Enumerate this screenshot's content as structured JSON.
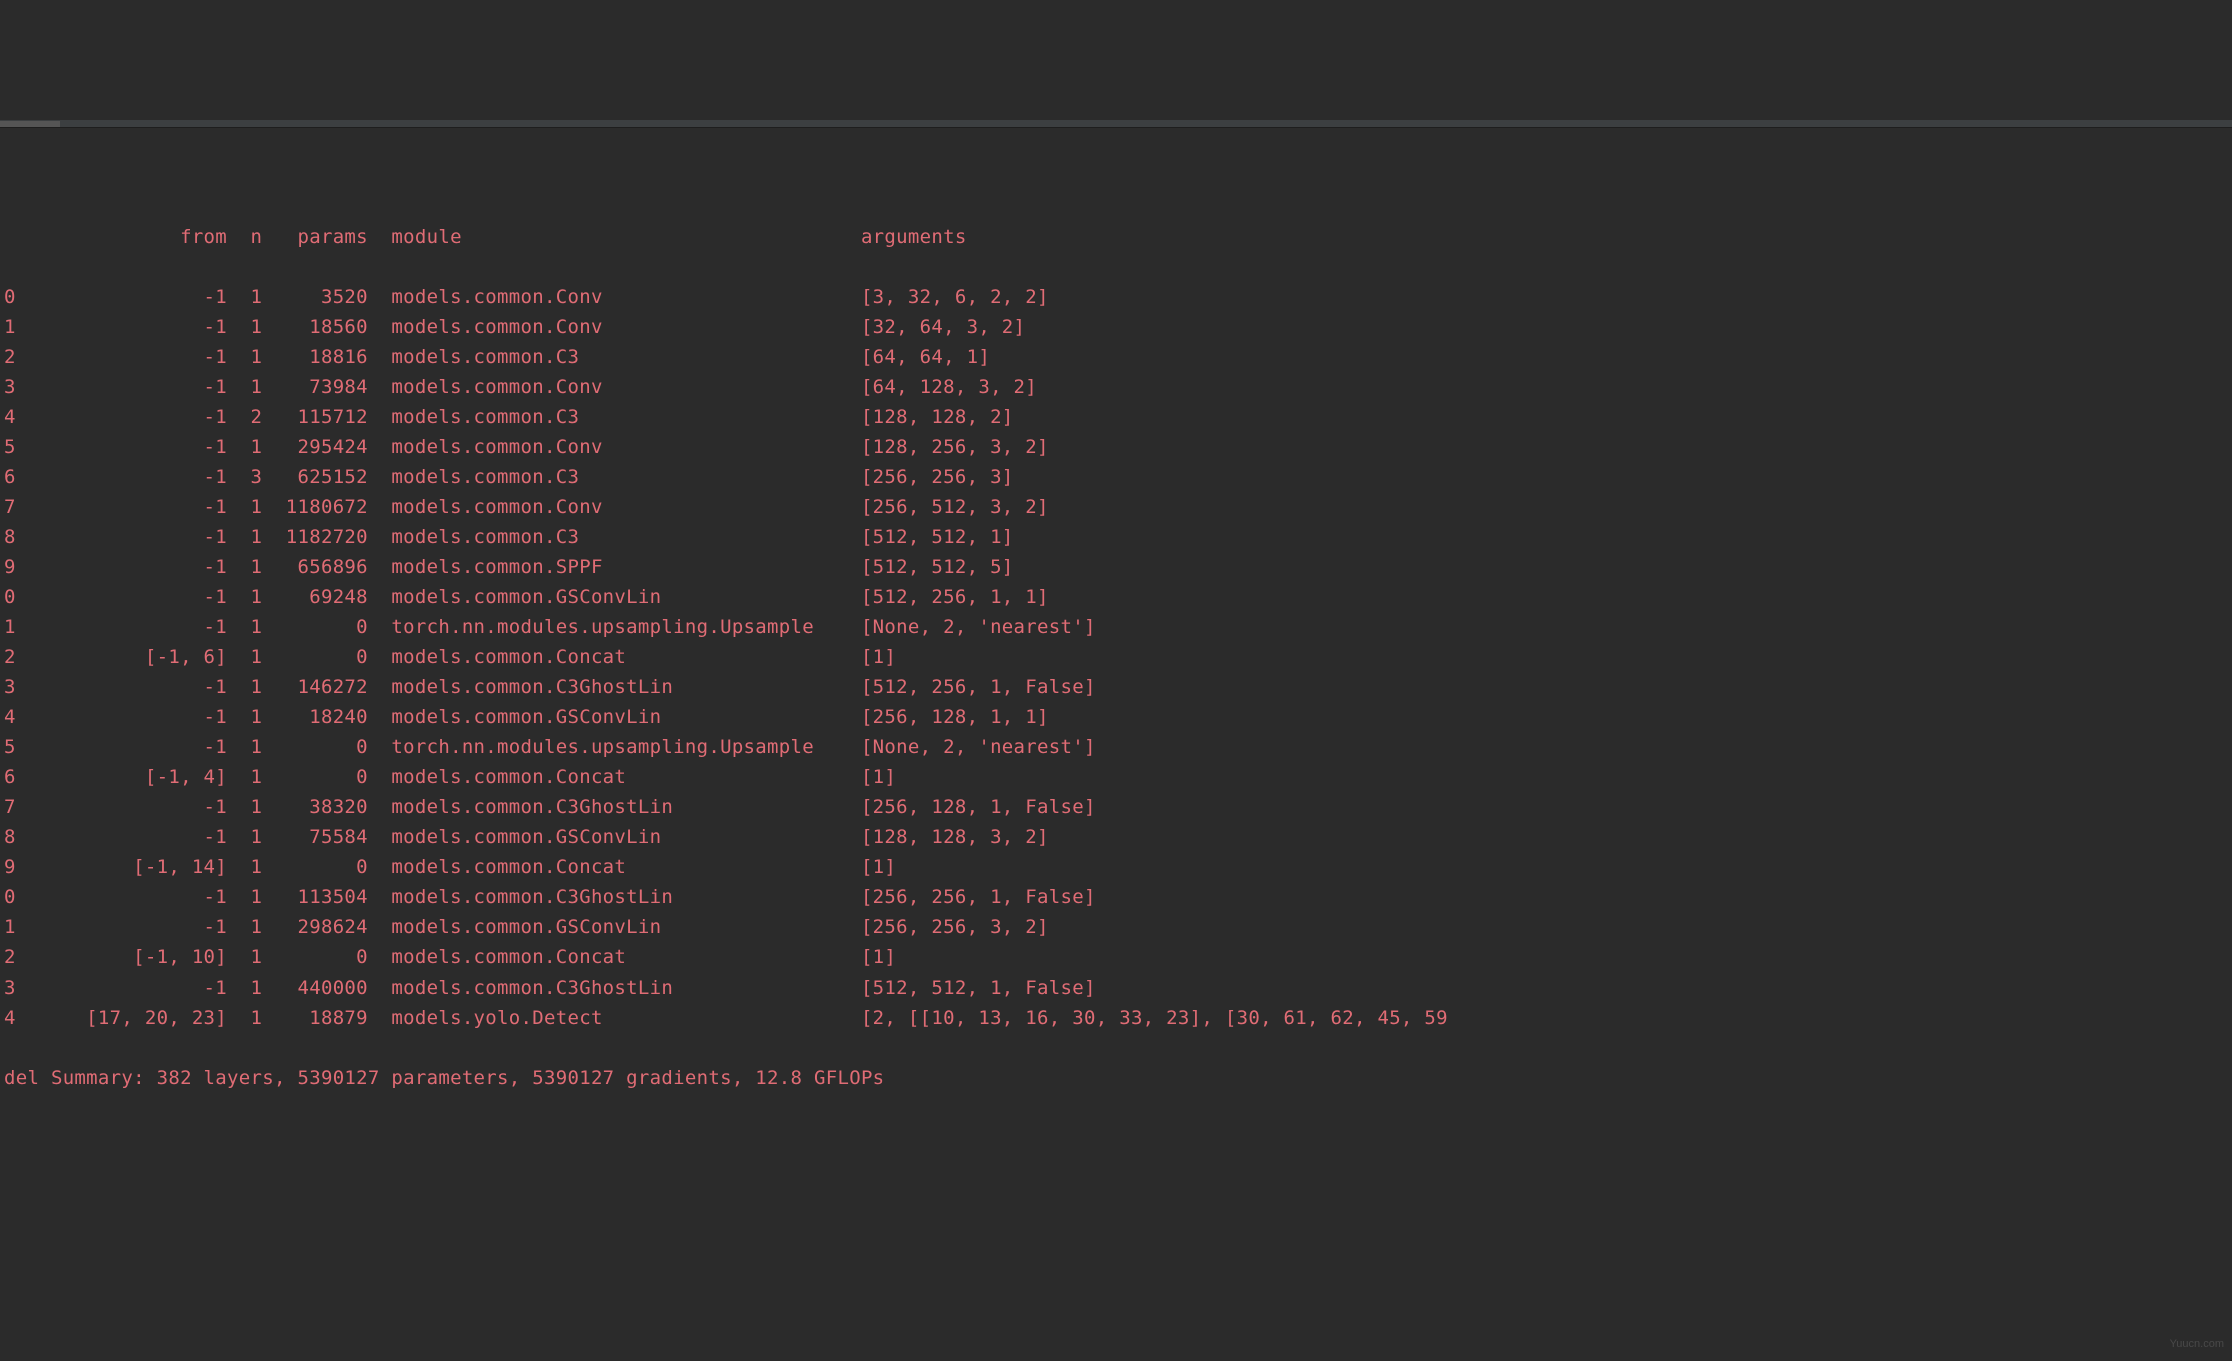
{
  "header": {
    "idx_spacer": "  ",
    "from_label": "from",
    "n_label": "n",
    "params_label": "params",
    "module_label": "module",
    "arguments_label": "arguments"
  },
  "rows": [
    {
      "idx": "0",
      "from": "-1",
      "n": "1",
      "params": "3520",
      "module": "models.common.Conv",
      "arguments": "[3, 32, 6, 2, 2]"
    },
    {
      "idx": "1",
      "from": "-1",
      "n": "1",
      "params": "18560",
      "module": "models.common.Conv",
      "arguments": "[32, 64, 3, 2]"
    },
    {
      "idx": "2",
      "from": "-1",
      "n": "1",
      "params": "18816",
      "module": "models.common.C3",
      "arguments": "[64, 64, 1]"
    },
    {
      "idx": "3",
      "from": "-1",
      "n": "1",
      "params": "73984",
      "module": "models.common.Conv",
      "arguments": "[64, 128, 3, 2]"
    },
    {
      "idx": "4",
      "from": "-1",
      "n": "2",
      "params": "115712",
      "module": "models.common.C3",
      "arguments": "[128, 128, 2]"
    },
    {
      "idx": "5",
      "from": "-1",
      "n": "1",
      "params": "295424",
      "module": "models.common.Conv",
      "arguments": "[128, 256, 3, 2]"
    },
    {
      "idx": "6",
      "from": "-1",
      "n": "3",
      "params": "625152",
      "module": "models.common.C3",
      "arguments": "[256, 256, 3]"
    },
    {
      "idx": "7",
      "from": "-1",
      "n": "1",
      "params": "1180672",
      "module": "models.common.Conv",
      "arguments": "[256, 512, 3, 2]"
    },
    {
      "idx": "8",
      "from": "-1",
      "n": "1",
      "params": "1182720",
      "module": "models.common.C3",
      "arguments": "[512, 512, 1]"
    },
    {
      "idx": "9",
      "from": "-1",
      "n": "1",
      "params": "656896",
      "module": "models.common.SPPF",
      "arguments": "[512, 512, 5]"
    },
    {
      "idx": "0",
      "from": "-1",
      "n": "1",
      "params": "69248",
      "module": "models.common.GSConvLin",
      "arguments": "[512, 256, 1, 1]"
    },
    {
      "idx": "1",
      "from": "-1",
      "n": "1",
      "params": "0",
      "module": "torch.nn.modules.upsampling.Upsample",
      "arguments": "[None, 2, 'nearest']"
    },
    {
      "idx": "2",
      "from": "[-1, 6]",
      "n": "1",
      "params": "0",
      "module": "models.common.Concat",
      "arguments": "[1]"
    },
    {
      "idx": "3",
      "from": "-1",
      "n": "1",
      "params": "146272",
      "module": "models.common.C3GhostLin",
      "arguments": "[512, 256, 1, False]"
    },
    {
      "idx": "4",
      "from": "-1",
      "n": "1",
      "params": "18240",
      "module": "models.common.GSConvLin",
      "arguments": "[256, 128, 1, 1]"
    },
    {
      "idx": "5",
      "from": "-1",
      "n": "1",
      "params": "0",
      "module": "torch.nn.modules.upsampling.Upsample",
      "arguments": "[None, 2, 'nearest']"
    },
    {
      "idx": "6",
      "from": "[-1, 4]",
      "n": "1",
      "params": "0",
      "module": "models.common.Concat",
      "arguments": "[1]"
    },
    {
      "idx": "7",
      "from": "-1",
      "n": "1",
      "params": "38320",
      "module": "models.common.C3GhostLin",
      "arguments": "[256, 128, 1, False]"
    },
    {
      "idx": "8",
      "from": "-1",
      "n": "1",
      "params": "75584",
      "module": "models.common.GSConvLin",
      "arguments": "[128, 128, 3, 2]"
    },
    {
      "idx": "9",
      "from": "[-1, 14]",
      "n": "1",
      "params": "0",
      "module": "models.common.Concat",
      "arguments": "[1]"
    },
    {
      "idx": "0",
      "from": "-1",
      "n": "1",
      "params": "113504",
      "module": "models.common.C3GhostLin",
      "arguments": "[256, 256, 1, False]"
    },
    {
      "idx": "1",
      "from": "-1",
      "n": "1",
      "params": "298624",
      "module": "models.common.GSConvLin",
      "arguments": "[256, 256, 3, 2]"
    },
    {
      "idx": "2",
      "from": "[-1, 10]",
      "n": "1",
      "params": "0",
      "module": "models.common.Concat",
      "arguments": "[1]"
    },
    {
      "idx": "3",
      "from": "-1",
      "n": "1",
      "params": "440000",
      "module": "models.common.C3GhostLin",
      "arguments": "[512, 512, 1, False]"
    },
    {
      "idx": "4",
      "from": "[17, 20, 23]",
      "n": "1",
      "params": "18879",
      "module": "models.yolo.Detect",
      "arguments": "[2, [[10, 13, 16, 30, 33, 23], [30, 61, 62, 45, 59"
    }
  ],
  "summary": "del Summary: 382 layers, 5390127 parameters, 5390127 gradients, 12.8 GFLOPs",
  "watermark": "Yuucn.com",
  "columns": {
    "idx_width": 1,
    "from_width": 18,
    "n_width": 3,
    "params_width": 9,
    "module_width": 40
  }
}
